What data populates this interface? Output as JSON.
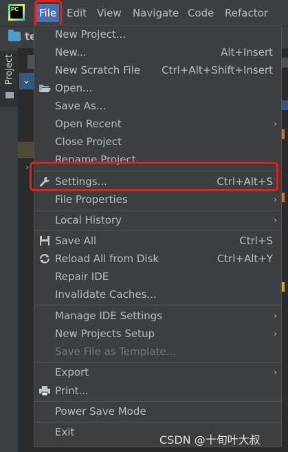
{
  "menubar": {
    "items": [
      {
        "label": "File"
      },
      {
        "label": "Edit"
      },
      {
        "label": "View"
      },
      {
        "label": "Navigate"
      },
      {
        "label": "Code"
      },
      {
        "label": "Refactor"
      }
    ],
    "app_logo_text": "PC",
    "app_logo_icon": "pycharm-logo-icon"
  },
  "breadcrumb": {
    "project": "te"
  },
  "left_tool_window": {
    "project_tab": "Project"
  },
  "file_menu": {
    "items": [
      {
        "label": "New Project..."
      },
      {
        "label": "New...",
        "shortcut": "Alt+Insert"
      },
      {
        "label": "New Scratch File",
        "shortcut": "Ctrl+Alt+Shift+Insert"
      },
      {
        "label": "Open...",
        "icon": "folder-open-icon"
      },
      {
        "label": "Save As..."
      },
      {
        "label": "Open Recent"
      },
      {
        "label": "Close Project"
      },
      {
        "label": "Rename Project..."
      },
      {
        "label": "Settings...",
        "shortcut": "Ctrl+Alt+S",
        "icon": "wrench-icon"
      },
      {
        "label": "File Properties"
      },
      {
        "label": "Local History"
      },
      {
        "label": "Save All",
        "shortcut": "Ctrl+S",
        "icon": "save-icon"
      },
      {
        "label": "Reload All from Disk",
        "shortcut": "Ctrl+Alt+Y",
        "icon": "reload-icon"
      },
      {
        "label": "Repair IDE"
      },
      {
        "label": "Invalidate Caches..."
      },
      {
        "label": "Manage IDE Settings"
      },
      {
        "label": "New Projects Setup"
      },
      {
        "label": "Save File as Template...",
        "disabled": true
      },
      {
        "label": "Export"
      },
      {
        "label": "Print...",
        "icon": "printer-icon"
      },
      {
        "label": "Power Save Mode"
      },
      {
        "label": "Exit"
      }
    ],
    "submenu_glyph": "›"
  },
  "watermark": "CSDN @十旬叶大叔",
  "colors": {
    "menubar_bg": "#3c3f41",
    "active_menu": "#4b6eaf",
    "highlight_box": "#e32020",
    "text": "#bbbbbb"
  }
}
